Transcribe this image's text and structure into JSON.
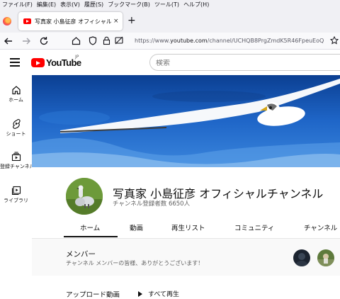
{
  "menubar": {
    "items": [
      "ファイル(F)",
      "編集(E)",
      "表示(V)",
      "履歴(S)",
      "ブックマーク(B)",
      "ツール(T)",
      "ヘルプ(H)"
    ]
  },
  "browser": {
    "tab_title": "写真家 小島征彦 オフィシャルチャンネル",
    "tab_close": "×",
    "new_tab": "+",
    "url_prefix": "https://www.",
    "url_domain": "youtube.com",
    "url_path": "/channel/UCHQB8PrgZmdK5R46FpeuEoQ"
  },
  "youtube": {
    "logo_text": "YouTube",
    "region": "JP",
    "search_placeholder": "検索"
  },
  "sidebar": {
    "items": [
      {
        "label": "ホーム",
        "icon": "home-icon"
      },
      {
        "label": "ショート",
        "icon": "shorts-icon"
      },
      {
        "label": "登録チャンネル",
        "icon": "subscriptions-icon"
      },
      {
        "label": "ライブラリ",
        "icon": "library-icon"
      }
    ]
  },
  "channel": {
    "title": "写真家 小島征彦 オフィシャルチャンネル",
    "subscribers": "チャンネル登録者数 6650人",
    "tabs": [
      "ホーム",
      "動画",
      "再生リスト",
      "コミュニティ",
      "チャンネル"
    ],
    "active_tab": "ホーム"
  },
  "members": {
    "title": "メンバー",
    "description": "チャンネル メンバーの皆様、ありがとうございます！"
  },
  "uploads": {
    "title": "アップロード動画",
    "play_all": "すべて再生"
  },
  "colors": {
    "brand_red": "#ff0000",
    "banner_blue": "#1d5fc0"
  }
}
